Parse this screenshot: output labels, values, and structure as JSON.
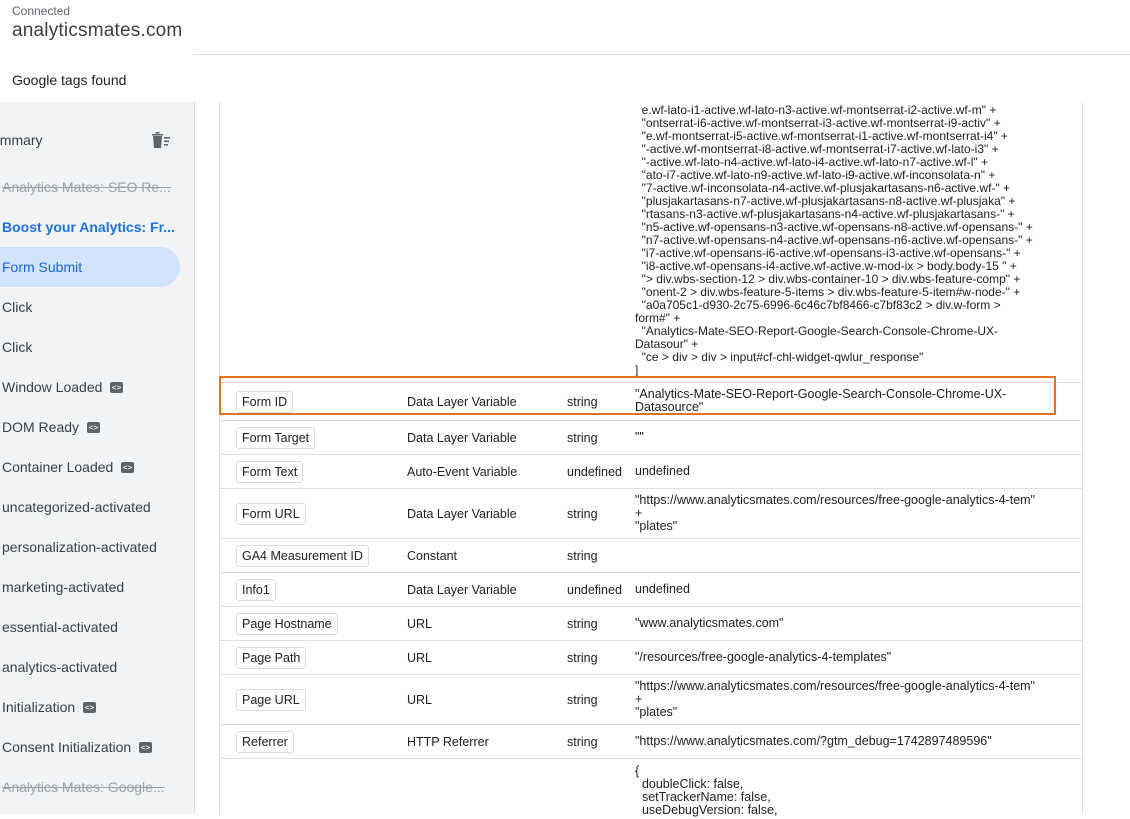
{
  "header": {
    "status": "Connected",
    "domain": "analyticsmates.com",
    "tags_found": "Google tags found"
  },
  "sidebar": {
    "summary": "ummary",
    "trash_icon": "delete-sweep-icon",
    "items": [
      {
        "label": "Analytics Mates: SEO Re...",
        "style": "strike",
        "badge": false
      },
      {
        "label": "Boost your Analytics: Fr...",
        "style": "bold",
        "badge": false
      },
      {
        "label": "Form Submit",
        "style": "selected",
        "badge": false
      },
      {
        "label": "Click",
        "style": "normal",
        "badge": false
      },
      {
        "label": "Click",
        "style": "normal",
        "badge": false
      },
      {
        "label": "Window Loaded",
        "style": "normal",
        "badge": true
      },
      {
        "label": "DOM Ready",
        "style": "normal",
        "badge": true
      },
      {
        "label": "Container Loaded",
        "style": "normal",
        "badge": true
      },
      {
        "label": "uncategorized-activated",
        "style": "normal",
        "badge": false
      },
      {
        "label": "personalization-activated",
        "style": "normal",
        "badge": false
      },
      {
        "label": "marketing-activated",
        "style": "normal",
        "badge": false
      },
      {
        "label": "essential-activated",
        "style": "normal",
        "badge": false
      },
      {
        "label": "analytics-activated",
        "style": "normal",
        "badge": false
      },
      {
        "label": "Initialization",
        "style": "normal",
        "badge": true
      },
      {
        "label": "Consent Initialization",
        "style": "normal",
        "badge": true
      },
      {
        "label": "Analytics Mates: Google...",
        "style": "strike",
        "badge": false
      }
    ],
    "badge_icon": "code-icon"
  },
  "table": {
    "top_value": "  e.wf-lato-i1-active.wf-lato-n3-active.wf-montserrat-i2-active.wf-m\" +\n  \"ontserrat-i6-active.wf-montserrat-i3-active.wf-montserrat-i9-activ\" +\n  \"e.wf-montserrat-i5-active.wf-montserrat-i1-active.wf-montserrat-i4\" +\n  \"-active.wf-montserrat-i8-active.wf-montserrat-i7-active.wf-lato-i3\" +\n  \"-active.wf-lato-n4-active.wf-lato-i4-active.wf-lato-n7-active.wf-l\" +\n  \"ato-i7-active.wf-lato-n9-active.wf-lato-i9-active.wf-inconsolata-n\" +\n  \"7-active.wf-inconsolata-n4-active.wf-plusjakartasans-n6-active.wf-\" +\n  \"plusjakartasans-n7-active.wf-plusjakartasans-n8-active.wf-plusjaka\" +\n  \"rtasans-n3-active.wf-plusjakartasans-n4-active.wf-plusjakartasans-\" +\n  \"n5-active.wf-opensans-n3-active.wf-opensans-n8-active.wf-opensans-\" +\n  \"n7-active.wf-opensans-n4-active.wf-opensans-n6-active.wf-opensans-\" +\n  \"i7-active.wf-opensans-i6-active.wf-opensans-i3-active.wf-opensans-\" +\n  \"i8-active.wf-opensans-i4-active.wf-active.w-mod-ix > body.body-15 \" +\n  \"> div.wbs-section-12 > div.wbs-container-10 > div.wbs-feature-comp\" +\n  \"onent-2 > div.wbs-feature-5-items > div.wbs-feature-5-item#w-node-\" +\n  \"a0a705c1-d930-2c75-6996-6c46c7bf8466-c7bf83c2 > div.w-form >\nform#\" +\n  \"Analytics-Mate-SEO-Report-Google-Search-Console-Chrome-UX-\nDatasour\" +\n  \"ce > div > div > input#cf-chl-widget-qwlur_response\"\n]",
    "rows": [
      {
        "name": "Form ID",
        "vtype": "Data Layer Variable",
        "rtype": "string",
        "value": "\"Analytics-Mate-SEO-Report-Google-Search-Console-Chrome-UX-\nDatasource\""
      },
      {
        "name": "Form Target",
        "vtype": "Data Layer Variable",
        "rtype": "string",
        "value": "\"\""
      },
      {
        "name": "Form Text",
        "vtype": "Auto-Event Variable",
        "rtype": "undefined",
        "value": "undefined"
      },
      {
        "name": "Form URL",
        "vtype": "Data Layer Variable",
        "rtype": "string",
        "value": "\"https://www.analyticsmates.com/resources/free-google-analytics-4-tem\"\n+\n\"plates\""
      },
      {
        "name": "GA4 Measurement ID",
        "vtype": "Constant",
        "rtype": "string",
        "value": ""
      },
      {
        "name": "Info1",
        "vtype": "Data Layer Variable",
        "rtype": "undefined",
        "value": "undefined"
      },
      {
        "name": "Page Hostname",
        "vtype": "URL",
        "rtype": "string",
        "value": "\"www.analyticsmates.com\""
      },
      {
        "name": "Page Path",
        "vtype": "URL",
        "rtype": "string",
        "value": "\"/resources/free-google-analytics-4-templates\""
      },
      {
        "name": "Page URL",
        "vtype": "URL",
        "rtype": "string",
        "value": "\"https://www.analyticsmates.com/resources/free-google-analytics-4-tem\"\n+\n\"plates\""
      },
      {
        "name": "Referrer",
        "vtype": "HTTP Referrer",
        "rtype": "string",
        "value": "\"https://www.analyticsmates.com/?gtm_debug=1742897489596\""
      }
    ],
    "object_value": "{\n  doubleClick: false,\n  setTrackerName: false,\n  useDebugVersion: false,"
  },
  "colors": {
    "highlight": "#e8711c",
    "selected_bg": "#d2e3fc",
    "accent": "#1a73e8"
  }
}
